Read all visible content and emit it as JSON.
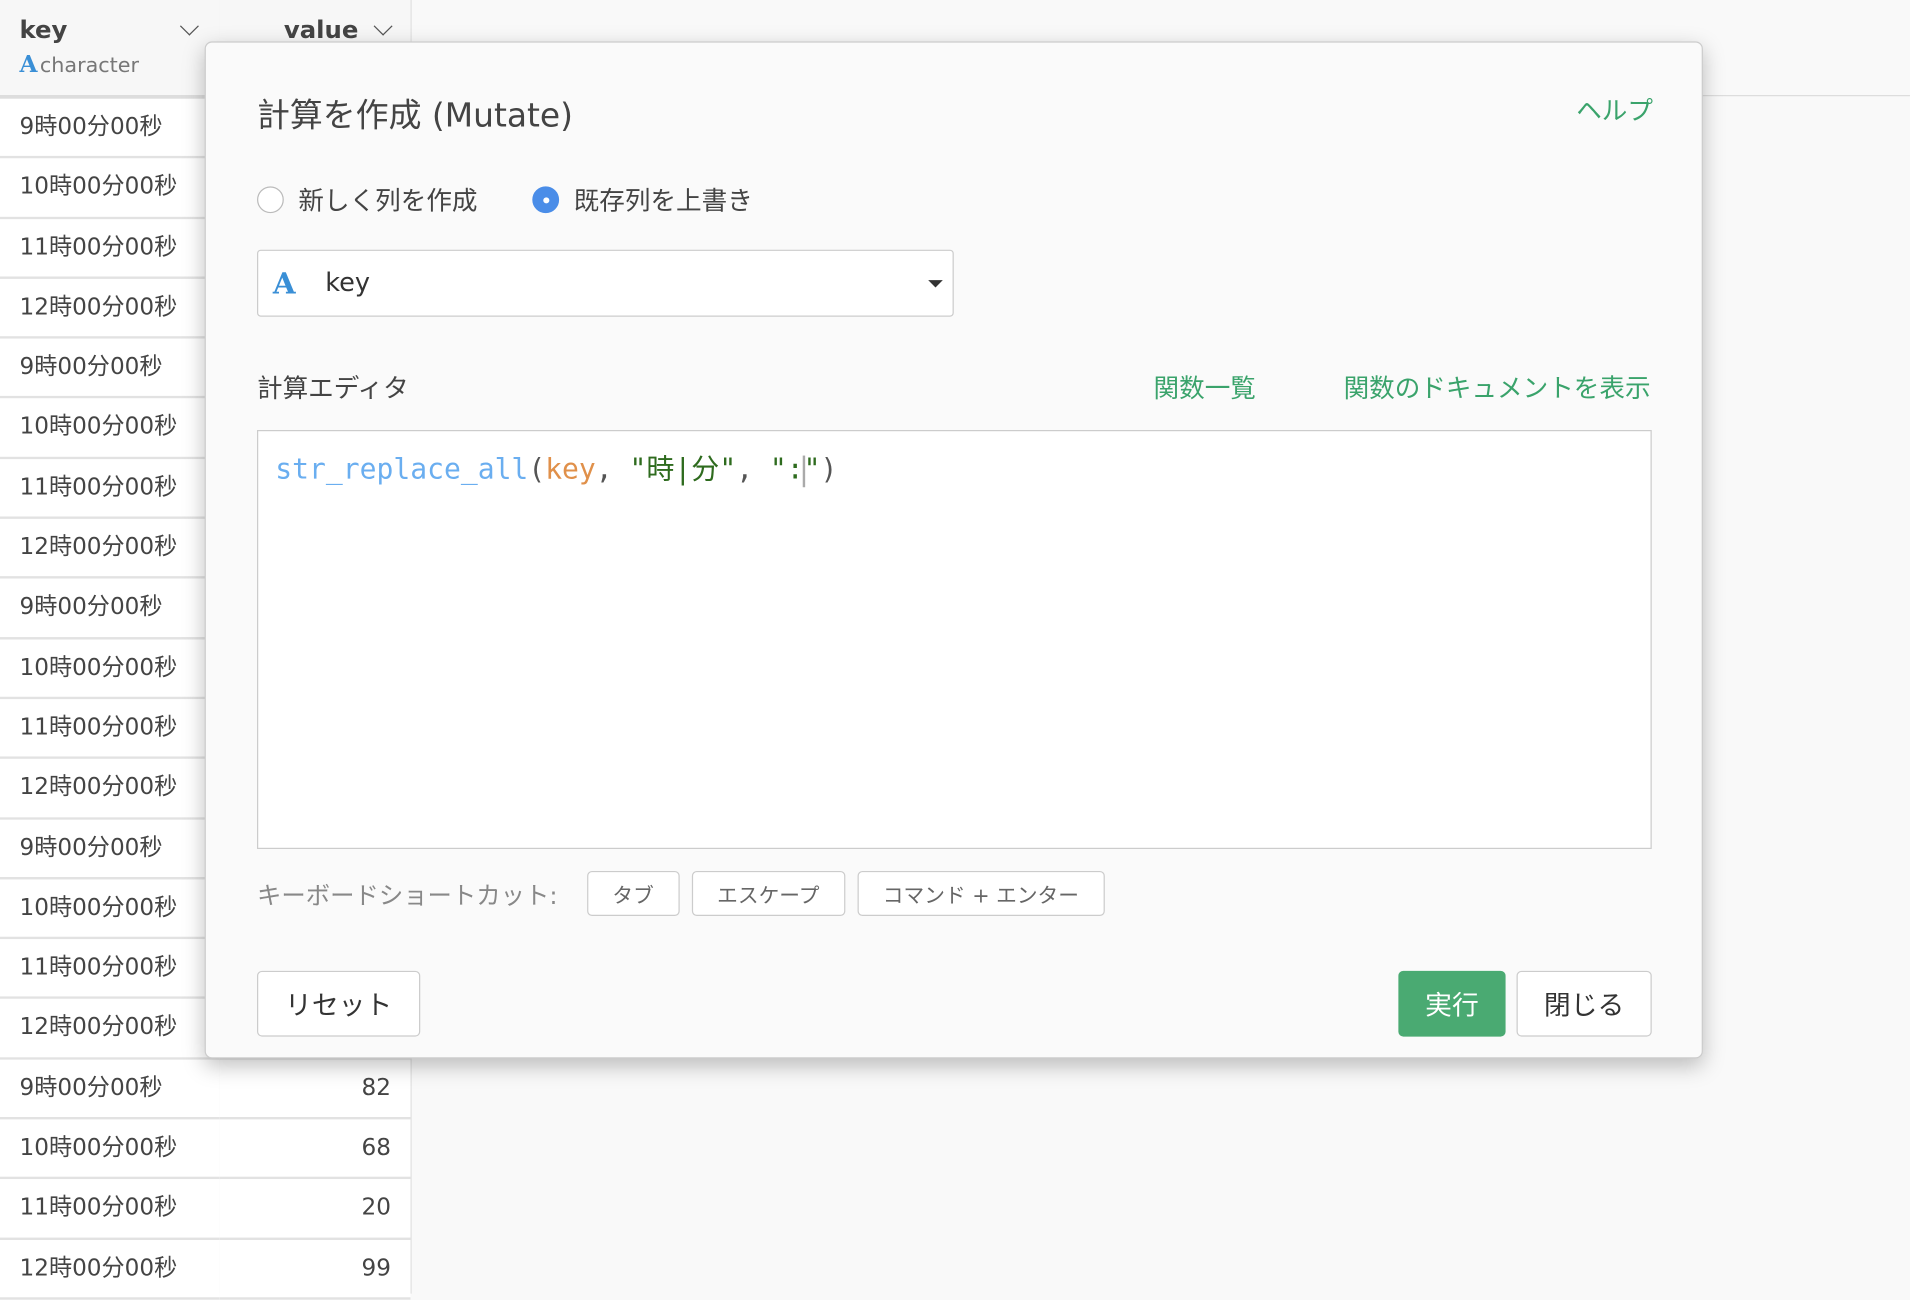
{
  "table": {
    "columns": [
      {
        "name": "key",
        "type": "character",
        "type_icon": "A"
      },
      {
        "name": "value"
      }
    ],
    "key_rows": [
      "9時00分00秒",
      "10時00分00秒",
      "11時00分00秒",
      "12時00分00秒",
      "9時00分00秒",
      "10時00分00秒",
      "11時00分00秒",
      "12時00分00秒",
      "9時00分00秒",
      "10時00分00秒",
      "11時00分00秒",
      "12時00分00秒",
      "9時00分00秒",
      "10時00分00秒",
      "11時00分00秒",
      "12時00分00秒",
      "9時00分00秒",
      "10時00分00秒",
      "11時00分00秒",
      "12時00分00秒"
    ],
    "visible_values": [
      "82",
      "68",
      "20",
      "99"
    ]
  },
  "dialog": {
    "title": "計算を作成 (Mutate)",
    "help": "ヘルプ",
    "radio_new": "新しく列を作成",
    "radio_overwrite": "既存列を上書き",
    "selected_mode": "overwrite",
    "column_select": {
      "type_icon": "A",
      "value": "key"
    },
    "editor_label": "計算エディタ",
    "function_list": "関数一覧",
    "function_docs": "関数のドキュメントを表示",
    "code": {
      "fn": "str_replace_all",
      "open": "(",
      "arg": "key",
      "comma1": ", ",
      "str1": "\"時|分\"",
      "comma2": ", ",
      "str2a": "\":",
      "str2b": "\"",
      "close": ")"
    },
    "shortcuts_label": "キーボードショートカット:",
    "shortcuts": [
      "タブ",
      "エスケープ",
      "コマンド + エンター"
    ],
    "reset": "リセット",
    "run": "実行",
    "close": "閉じる"
  },
  "colors": {
    "accent_green": "#4aaa72",
    "link_green": "#3aa36b",
    "radio_blue": "#4a8de8",
    "type_blue": "#3a8fd6"
  }
}
